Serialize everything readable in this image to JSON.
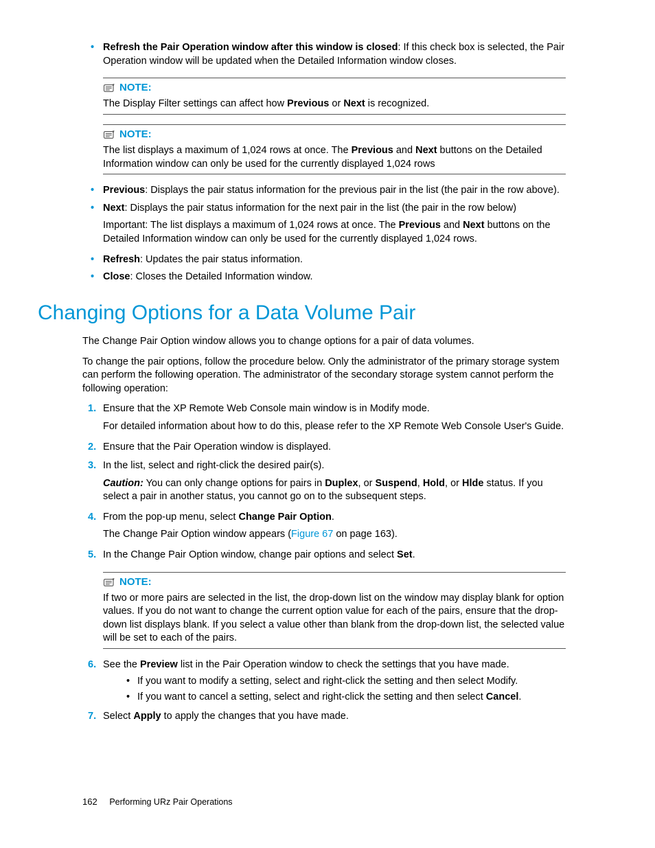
{
  "top_bullets": {
    "refresh_pair": {
      "title": "Refresh the Pair Operation window after this window is closed",
      "text": ": If this check box is selected, the Pair Operation window will be updated when the Detailed Information window closes."
    }
  },
  "note1": {
    "label": "NOTE:",
    "body_pre": "The Display Filter settings can affect how ",
    "bold1": "Previous",
    "mid": " or ",
    "bold2": "Next",
    "body_post": " is recognized."
  },
  "note2": {
    "label": "NOTE:",
    "body_pre": "The list displays a maximum of 1,024 rows at once. The ",
    "bold1": "Previous",
    "mid": " and ",
    "bold2": "Next",
    "body_post": " buttons on the Detailed Information window can only be used for the currently displayed 1,024 rows"
  },
  "mid_bullets": {
    "previous": {
      "title": "Previous",
      "text": ": Displays the pair status information for the previous pair in the list (the pair in the row above)."
    },
    "next": {
      "title": "Next",
      "text": ": Displays the pair status information for the next pair in the list (the pair in the row below)"
    },
    "important_pre": "Important: The list displays a maximum of 1,024 rows at once. The ",
    "important_b1": "Previous",
    "important_mid": " and ",
    "important_b2": "Next",
    "important_post": " buttons on the Detailed Information window can only be used for the currently displayed 1,024 rows.",
    "refresh": {
      "title": "Refresh",
      "text": ": Updates the pair status information."
    },
    "close": {
      "title": "Close",
      "text": ": Closes the Detailed Information window."
    }
  },
  "heading": "Changing Options for a Data Volume Pair",
  "intro1": "The Change Pair Option window allows you to change options for a pair of data volumes.",
  "intro2": "To change the pair options, follow the procedure below. Only the administrator of the primary storage system can perform the following operation. The administrator of the secondary storage system cannot perform the following operation:",
  "steps": {
    "s1a": "Ensure that the XP Remote Web Console main window is in Modify mode.",
    "s1b": "For detailed information about how to do this, please refer to the XP Remote Web Console User's Guide.",
    "s2": "Ensure that the Pair Operation window is displayed.",
    "s3": "In the list, select and right-click the desired pair(s).",
    "s3_caution_label": "Caution:",
    "s3_caution_pre": " You can only change options for pairs in ",
    "s3_b1": "Duplex",
    "s3_m1": ", or ",
    "s3_b2": "Suspend",
    "s3_m2": ", ",
    "s3_b3": "Hold",
    "s3_m3": ", or ",
    "s3_b4": "Hlde",
    "s3_caution_post": " status. If you select a pair in another status, you cannot go on to the subsequent steps.",
    "s4_pre": "From the pop-up menu, select ",
    "s4_bold": "Change Pair Option",
    "s4_post": ".",
    "s4b_pre": "The Change Pair Option window appears (",
    "s4b_link": "Figure 67",
    "s4b_post": " on page 163).",
    "s5_pre": "In the Change Pair Option window, change pair options and select ",
    "s5_bold": "Set",
    "s5_post": "."
  },
  "note3": {
    "label": "NOTE:",
    "body": "If two or more pairs are selected in the list, the drop-down list on the window may display blank for option values. If you do not want to change the current option value for each of the pairs, ensure that the drop-down list displays blank. If you select a value other than blank from the drop-down list, the selected value will be set to each of the pairs."
  },
  "steps2": {
    "s6_pre": "See the ",
    "s6_bold": "Preview",
    "s6_post": " list in the Pair Operation window to check the settings that you have made.",
    "s6_sub1": "If you want to modify a setting, select and right-click the setting and then select Modify.",
    "s6_sub2_pre": "If you want to cancel a setting, select and right-click the setting and then select ",
    "s6_sub2_bold": "Cancel",
    "s6_sub2_post": ".",
    "s7_pre": "Select ",
    "s7_bold": "Apply",
    "s7_post": " to apply the changes that you have made."
  },
  "footer": {
    "page": "162",
    "section": "Performing URz Pair Operations"
  }
}
